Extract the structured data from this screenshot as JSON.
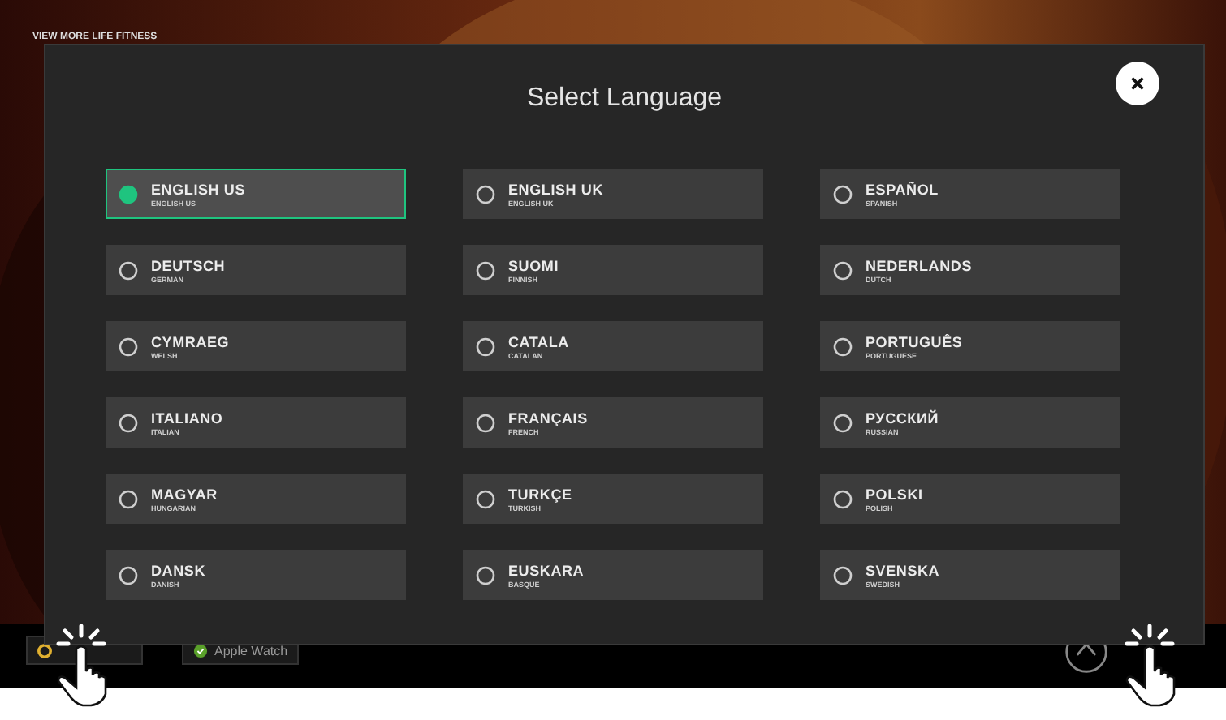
{
  "background": {
    "link": "VIEW MORE LIFE FITNESS",
    "chips": [
      {
        "label": "Apple Watch"
      }
    ]
  },
  "dialog": {
    "title": "Select Language",
    "languages": [
      {
        "name": "ENGLISH US",
        "english": "ENGLISH US",
        "selected": true
      },
      {
        "name": "ENGLISH UK",
        "english": "ENGLISH UK",
        "selected": false
      },
      {
        "name": "ESPAÑOL",
        "english": "SPANISH",
        "selected": false
      },
      {
        "name": "DEUTSCH",
        "english": "GERMAN",
        "selected": false
      },
      {
        "name": "SUOMI",
        "english": "FINNISH",
        "selected": false
      },
      {
        "name": "NEDERLANDS",
        "english": "DUTCH",
        "selected": false
      },
      {
        "name": "CYMRAEG",
        "english": "WELSH",
        "selected": false
      },
      {
        "name": "CATALA",
        "english": "CATALAN",
        "selected": false
      },
      {
        "name": "PORTUGUÊS",
        "english": "PORTUGUESE",
        "selected": false
      },
      {
        "name": "ITALIANO",
        "english": "ITALIAN",
        "selected": false
      },
      {
        "name": "FRANÇAIS",
        "english": "FRENCH",
        "selected": false
      },
      {
        "name": "РУССКИЙ",
        "english": "RUSSIAN",
        "selected": false
      },
      {
        "name": "MAGYAR",
        "english": "HUNGARIAN",
        "selected": false
      },
      {
        "name": "TURKÇE",
        "english": "TURKISH",
        "selected": false
      },
      {
        "name": "POLSKI",
        "english": "POLISH",
        "selected": false
      },
      {
        "name": "DANSK",
        "english": "DANISH",
        "selected": false
      },
      {
        "name": "EUSKARA",
        "english": "BASQUE",
        "selected": false
      },
      {
        "name": "SVENSKA",
        "english": "SWEDISH",
        "selected": false
      }
    ]
  }
}
